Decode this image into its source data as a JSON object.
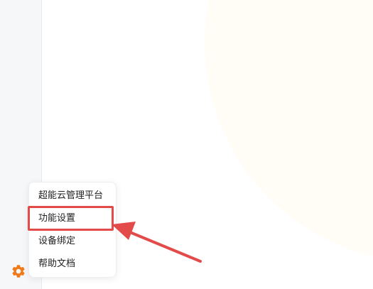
{
  "menu": {
    "items": [
      {
        "label": "超能云管理平台"
      },
      {
        "label": "功能设置"
      },
      {
        "label": "设备绑定"
      },
      {
        "label": "帮助文档"
      }
    ]
  },
  "colors": {
    "accent": "#f07a1a",
    "annotation": "#e34b4b"
  },
  "icons": {
    "settings": "gear-icon"
  }
}
